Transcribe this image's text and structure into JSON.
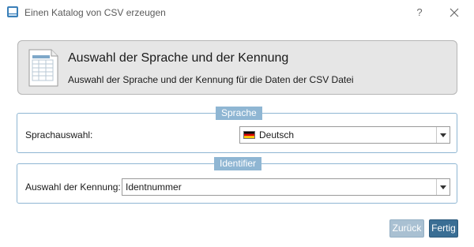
{
  "window": {
    "title": "Einen Katalog von CSV erzeugen",
    "help_symbol": "?"
  },
  "header": {
    "title": "Auswahl der Sprache und der Kennung",
    "subtitle": "Auswahl der Sprache und der Kennung für die Daten der CSV Datei"
  },
  "language_group": {
    "legend": "Sprache",
    "label": "Sprachauswahl:",
    "selected": "Deutsch",
    "flag_colors": [
      "#000000",
      "#dd0000",
      "#ffce00"
    ]
  },
  "identifier_group": {
    "legend": "Identifier",
    "label": "Auswahl der Kennung:",
    "selected": "Identnummer"
  },
  "buttons": {
    "back": "Zurück",
    "finish": "Fertig"
  },
  "colors": {
    "group_border": "#8fb6d3",
    "header_bg": "#e6e6e6",
    "primary_button": "#3a6e94",
    "disabled_button": "#a9c0d2"
  }
}
